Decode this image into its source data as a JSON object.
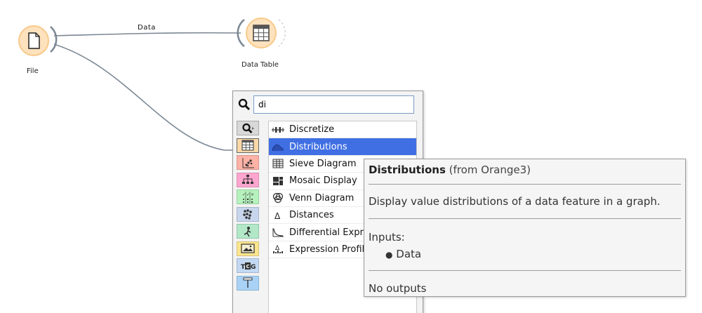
{
  "canvas": {
    "nodes": {
      "file": {
        "label": "File",
        "icon": "document-icon"
      },
      "data_table": {
        "label": "Data Table",
        "icon": "table-icon"
      }
    },
    "links": {
      "file_to_table": {
        "label": "Data"
      }
    }
  },
  "quick_menu": {
    "search": {
      "value": "di"
    },
    "categories": [
      {
        "name": "search",
        "icon": "search-icon",
        "color": "#d8d8d8"
      },
      {
        "name": "data",
        "icon": "table-icon",
        "color": "#fbd8a8"
      },
      {
        "name": "visualize",
        "icon": "scatter-icon",
        "color": "#ffb2a6"
      },
      {
        "name": "model",
        "icon": "tree-icon",
        "color": "#ffa6cf"
      },
      {
        "name": "evaluate",
        "icon": "confusion-matrix-icon",
        "color": "#b6f2bd"
      },
      {
        "name": "unsupervised",
        "icon": "cluster-icon",
        "color": "#c7d6ec"
      },
      {
        "name": "bioinformatics",
        "icon": "figure-icon",
        "color": "#b2e8c8"
      },
      {
        "name": "image-analytics",
        "icon": "image-icon",
        "color": "#fbe58e"
      },
      {
        "name": "text-mining",
        "icon": "tcg-icon",
        "color": "#c3d8f2"
      },
      {
        "name": "other",
        "icon": "widget-icon",
        "color": "#a9d2f6"
      }
    ],
    "items": [
      {
        "label": "Discretize",
        "icon": "discretize-icon"
      },
      {
        "label": "Distributions",
        "icon": "distributions-icon"
      },
      {
        "label": "Sieve Diagram",
        "icon": "sieve-icon"
      },
      {
        "label": "Mosaic Display",
        "icon": "mosaic-icon"
      },
      {
        "label": "Venn Diagram",
        "icon": "venn-icon"
      },
      {
        "label": "Distances",
        "icon": "delta-icon"
      },
      {
        "label": "Differential Expression",
        "icon": "curve-icon"
      },
      {
        "label": "Expression Profiles",
        "icon": "expression-icon"
      }
    ],
    "selected_index": 1
  },
  "tooltip": {
    "name": "Distributions",
    "source": "(from Orange3)",
    "description": "Display value distributions of a data feature in a graph.",
    "inputs_title": "Inputs:",
    "inputs": [
      "Data"
    ],
    "outputs": "No outputs"
  },
  "colors": {
    "node_fill": "#fde2bd",
    "node_border": "#f9c98a",
    "selection": "#3f6fe3",
    "link": "#7b8793"
  }
}
